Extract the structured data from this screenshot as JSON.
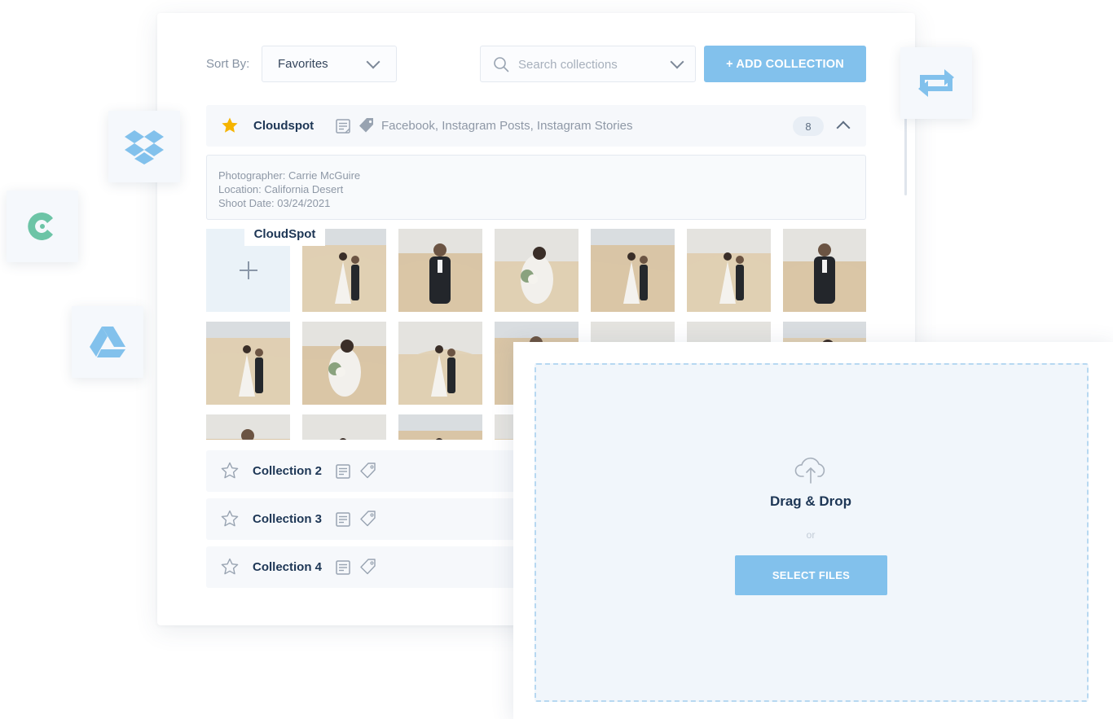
{
  "toolbar": {
    "sort_label": "Sort By:",
    "sort_value": "Favorites",
    "search_placeholder": "Search collections",
    "add_button": "+ ADD COLLECTION"
  },
  "collections": [
    {
      "title": "Cloudspot",
      "favorite": true,
      "tags": "Facebook, Instagram Posts, Instagram Stories",
      "count": "8",
      "expanded": true
    },
    {
      "title": "Collection 2",
      "favorite": false
    },
    {
      "title": "Collection 3",
      "favorite": false
    },
    {
      "title": "Collection 4",
      "favorite": false
    }
  ],
  "details": {
    "photographer": "Photographer: Carrie McGuire",
    "location": "Location: California Desert",
    "shoot_date": "Shoot Date: 03/24/2021"
  },
  "tooltip": "CloudSpot",
  "integrations": [
    "dropbox-icon",
    "cloudspot-icon",
    "google-drive-icon",
    "sync-icon"
  ],
  "upload": {
    "title": "Drag & Drop",
    "or": "or",
    "button": "SELECT FILES"
  },
  "colors": {
    "accent": "#82c1ec",
    "star": "#f5b400",
    "navy": "#1d3655",
    "cloudspot": "#6cc4a6"
  }
}
